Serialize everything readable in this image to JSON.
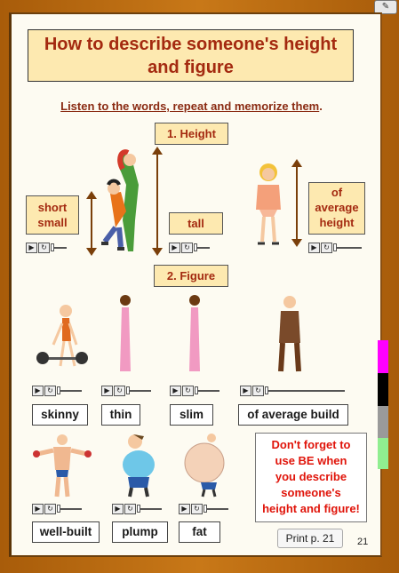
{
  "title": "How to describe someone's height and figure",
  "instruction": "Listen to the words, repeat and memorize them",
  "instruction_suffix": ".",
  "sections": {
    "height": "1. Height",
    "figure": "2. Figure"
  },
  "height_words": {
    "short_small_line1": "short",
    "short_small_line2": "small",
    "tall": "tall",
    "average_line1": "of",
    "average_line2": "average",
    "average_line3": "height"
  },
  "figure_words": {
    "skinny": "skinny",
    "thin": "thin",
    "slim": "slim",
    "average_build": "of average build",
    "well_built": "well-built",
    "plump": "plump",
    "fat": "fat"
  },
  "reminder": {
    "line1": "Don't forget to",
    "line2": "use BE when",
    "line3": "you describe",
    "line4": "someone's",
    "line5": "height and figure!"
  },
  "print_button": "Print p. 21",
  "page_number": "21",
  "player_icons": {
    "play": "play-icon",
    "replay": "replay-icon"
  },
  "colors": {
    "frame": "#b86a10",
    "title_bg": "#fde9b0",
    "title_text": "#a42a10",
    "reminder_text": "#e0140a",
    "tab_colors": [
      "#ff00ff",
      "#000000",
      "#9a9a9a",
      "#90ee90"
    ]
  }
}
